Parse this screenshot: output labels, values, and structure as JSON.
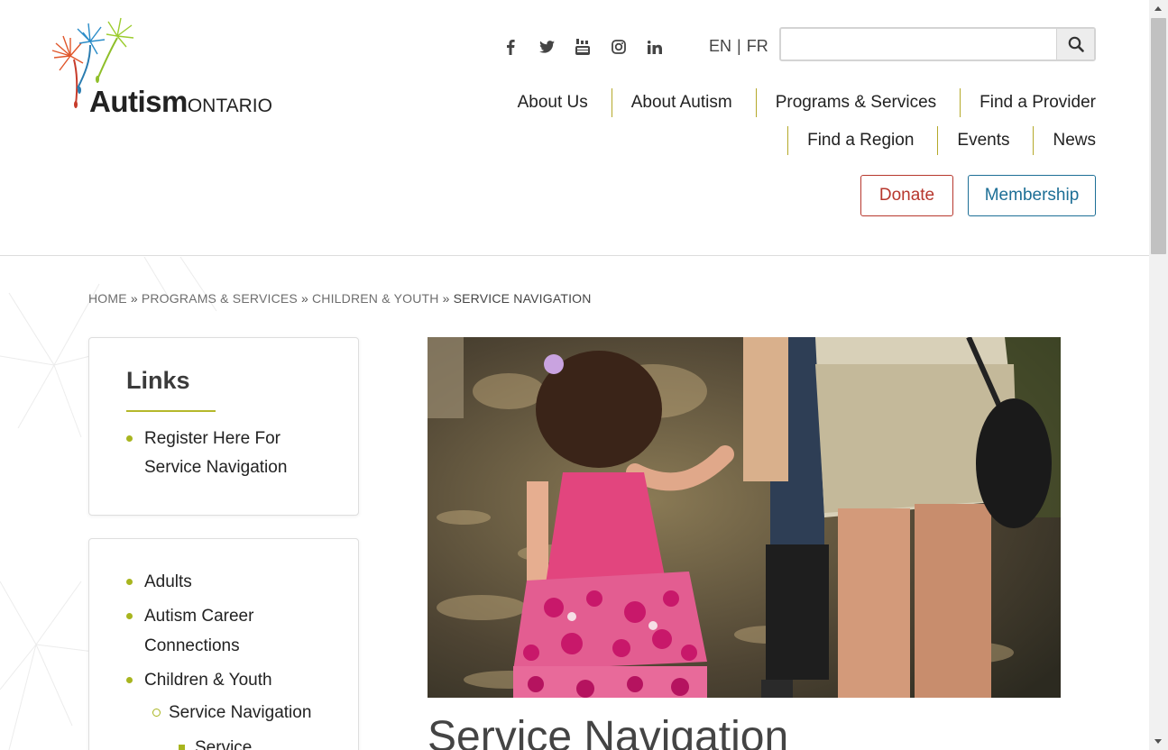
{
  "brand": {
    "name_bold": "Autism",
    "name_light": "ONTARIO",
    "colors": {
      "accent_olive": "#a8b51f",
      "donate_red": "#b7372d",
      "member_blue": "#1d6f96"
    }
  },
  "social": [
    "facebook-icon",
    "twitter-icon",
    "youtube-icon",
    "instagram-icon",
    "linkedin-icon"
  ],
  "language": {
    "en": "EN",
    "separator": "|",
    "fr": "FR"
  },
  "search": {
    "value": "",
    "placeholder": ""
  },
  "nav": {
    "row1": [
      "About Us",
      "About Autism",
      "Programs & Services",
      "Find a Provider"
    ],
    "row2": [
      "Find a Region",
      "Events",
      "News"
    ]
  },
  "buttons": {
    "donate": "Donate",
    "membership": "Membership"
  },
  "breadcrumb": {
    "home": "HOME",
    "sep": "»",
    "programs": "PROGRAMS & SERVICES",
    "children": "CHILDREN & YOUTH",
    "current": "SERVICE NAVIGATION"
  },
  "links_card": {
    "title": "Links",
    "items": [
      "Register Here For",
      "Service Navigation"
    ]
  },
  "sidebar_nav": {
    "adults": "Adults",
    "career_1": "Autism Career",
    "career_2": "Connections",
    "children": "Children & Youth",
    "service_nav": "Service Navigation",
    "service_sub": "Service"
  },
  "page_title": "Service Navigation"
}
